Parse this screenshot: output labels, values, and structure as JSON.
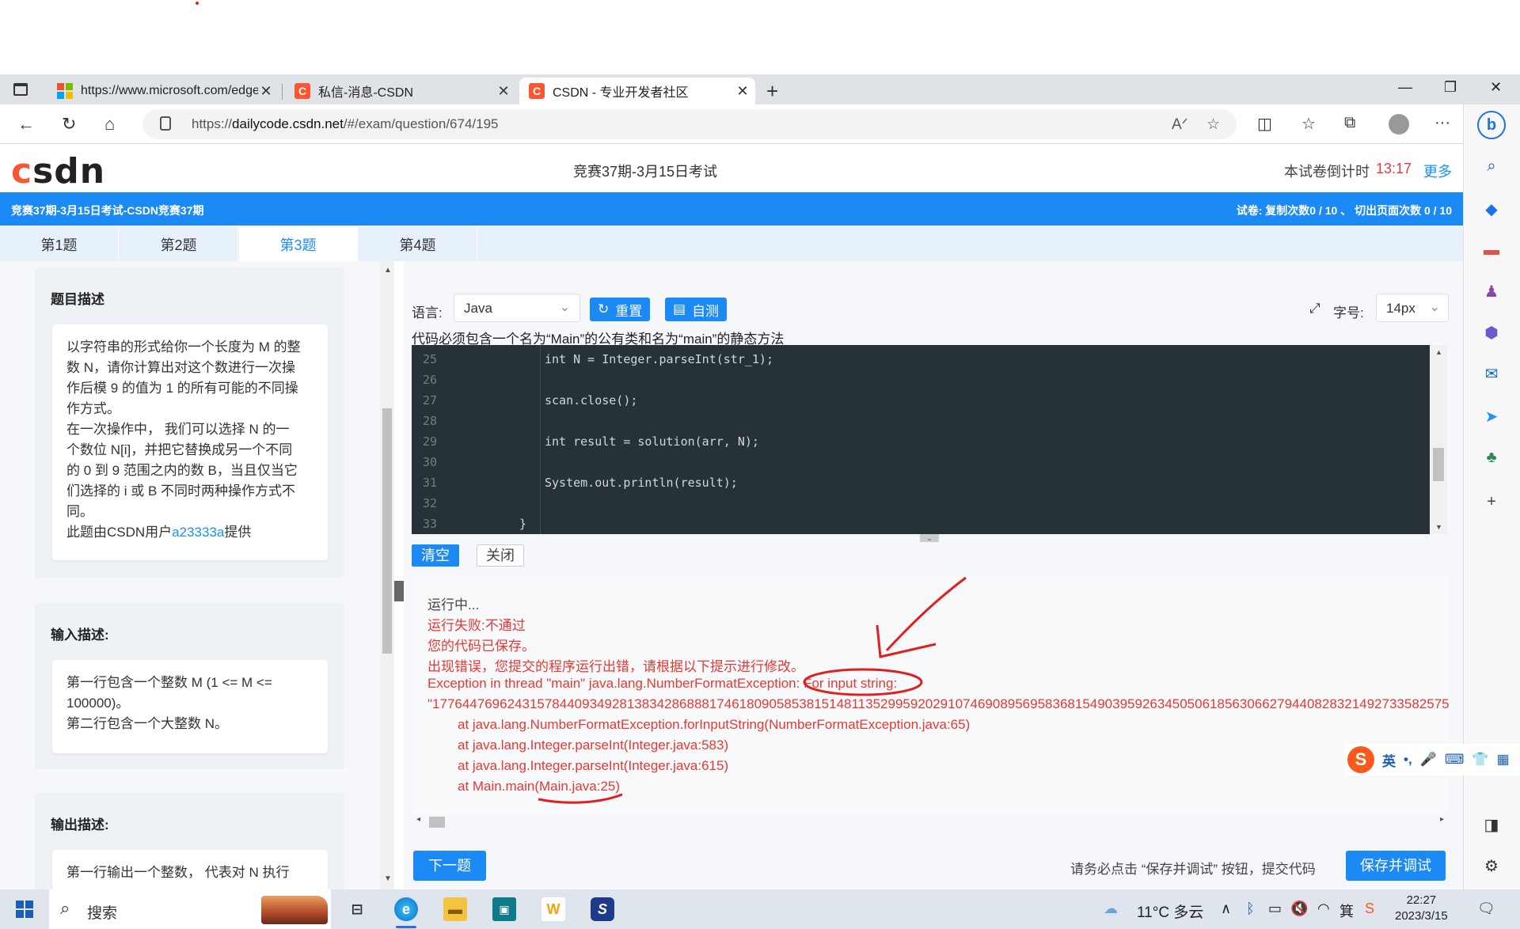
{
  "browser": {
    "tabs": [
      {
        "label": "https://www.microsoft.com/edge",
        "active": false
      },
      {
        "label": "私信-消息-CSDN",
        "active": false
      },
      {
        "label": "CSDN - 专业开发者社区",
        "active": true
      }
    ],
    "url_prefix": "https://",
    "url_domain": "dailycode.csdn.net",
    "url_path": "/#/exam/question/674/195"
  },
  "header": {
    "logo": "CSDN",
    "exam_title": "竞赛37期-3月15日考试",
    "countdown_label": "本试卷倒计时",
    "countdown_value": "13:17",
    "more": "更多"
  },
  "banner": {
    "left": "竞赛37期-3月15日考试-CSDN竞赛37期",
    "right": "试卷:    复制次数0 / 10 、 切出页面次数 0 / 10"
  },
  "question_tabs": [
    "第1题",
    "第2题",
    "第3题",
    "第4题"
  ],
  "problem": {
    "desc_title": "题目描述",
    "desc_lines": [
      "以字符串的形式给你一个长度为 M 的整",
      "数 N，请你计算出对这个数进行一次操",
      "作后模 9 的值为 1 的所有可能的不同操",
      "作方式。",
      "在一次操作中， 我们可以选择 N 的一",
      "个数位 N[i]，并把它替换成另一个不同",
      "的 0 到 9 范围之内的数 B，当且仅当它",
      "们选择的 i 或 B 不同时两种操作方式不",
      "同。"
    ],
    "credit_prefix": "此题由CSDN用户",
    "credit_user": "a23333a",
    "credit_suffix": "提供",
    "input_title": "输入描述:",
    "input_lines": [
      "第一行包含一个整数 M (1 <= M <=",
      "100000)。",
      "第二行包含一个大整数 N。"
    ],
    "output_title": "输出描述:",
    "output_lines": [
      "第一行输出一个整数， 代表对 N 执行"
    ]
  },
  "editor": {
    "lang_label": "语言:",
    "lang_value": "Java",
    "reset": "重置",
    "selftest": "自测",
    "font_label": "字号:",
    "font_value": "14px",
    "hint": "代码必须包含一个名为“Main”的公有类和名为“main”的静态方法",
    "lines": [
      {
        "n": "25",
        "code": "int N = Integer.parseInt(str_1);"
      },
      {
        "n": "26",
        "code": ""
      },
      {
        "n": "27",
        "code": "scan.close();"
      },
      {
        "n": "28",
        "code": ""
      },
      {
        "n": "29",
        "code": "int result = solution(arr, N);"
      },
      {
        "n": "30",
        "code": ""
      },
      {
        "n": "31",
        "code": "System.out.println(result);"
      },
      {
        "n": "32",
        "code": ""
      },
      {
        "n": "33",
        "code": "}"
      }
    ],
    "clear": "清空",
    "close": "关闭"
  },
  "console": {
    "lines": [
      "运行中...",
      "运行失败:不通过",
      "您的代码已保存。",
      "出现错误，您提交的程序运行出错，请根据以下提示进行修改。",
      "Exception in thread \"main\" java.lang.NumberFormatException: For input string:",
      "\"1776447696243157844093492813834286888174618090585381514811352995920291074690895695836815490395926345050618563066279440828321492733582575",
      "at java.lang.NumberFormatException.forInputString(NumberFormatException.java:65)",
      "at java.lang.Integer.parseInt(Integer.java:583)",
      "at java.lang.Integer.parseInt(Integer.java:615)",
      "at Main.main(Main.java:25)"
    ]
  },
  "footer": {
    "next": "下一题",
    "tip": "请务必点击 “保存并调试” 按钮，提交代码",
    "save": "保存并调试"
  },
  "ime": {
    "lang": "英"
  },
  "taskbar": {
    "search": "搜索",
    "weather": "11°C 多云",
    "time": "22:27",
    "date": "2023/3/15"
  },
  "colors": {
    "accent": "#1c8af5",
    "csdn_red": "#fc5531",
    "error": "#e53935",
    "editor_bg": "#263238"
  }
}
